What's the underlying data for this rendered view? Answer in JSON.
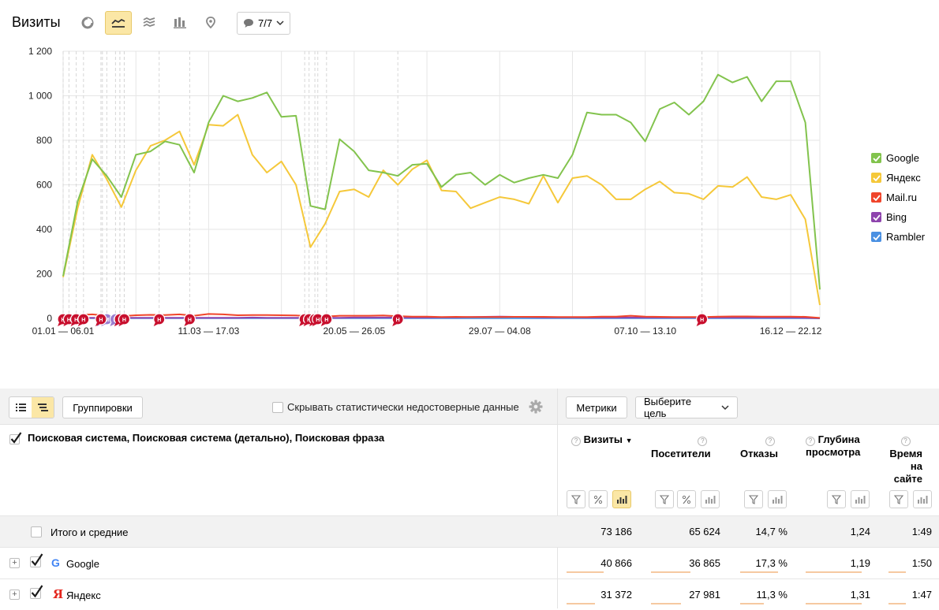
{
  "header": {
    "title": "Визиты",
    "series_dropdown": "7/7"
  },
  "colors": {
    "accent": "#fbe7a6",
    "google": "#82c34d",
    "yandex": "#f5c83a",
    "mailru": "#f0452b",
    "bing": "#8e44ad",
    "rambler": "#4a90e2",
    "annotation": "#c8102e",
    "bing_annotation": "#9b7fd0"
  },
  "chart_data": {
    "type": "line",
    "title": "Визиты",
    "ylim": [
      0,
      1200
    ],
    "y_ticks": [
      "1 200",
      "1 000",
      "800",
      "600",
      "400",
      "200",
      "0"
    ],
    "x_tick_labels": [
      "01.01 — 06.01",
      "11.03 — 17.03",
      "20.05 — 26.05",
      "29.07 — 04.08",
      "07.10 — 13.10",
      "16.12 — 22.12"
    ],
    "x_tick_weeks": [
      0,
      10,
      20,
      30,
      40,
      50
    ],
    "weeks": 53,
    "series": [
      {
        "name": "Google",
        "color": "#82c34d",
        "values": [
          190,
          525,
          715,
          640,
          545,
          735,
          750,
          795,
          780,
          655,
          880,
          1000,
          975,
          990,
          1015,
          905,
          910,
          505,
          490,
          805,
          750,
          665,
          655,
          640,
          690,
          695,
          590,
          645,
          655,
          600,
          645,
          610,
          630,
          645,
          630,
          735,
          925,
          915,
          915,
          880,
          795,
          940,
          970,
          915,
          975,
          1095,
          1060,
          1085,
          975,
          1065,
          1065,
          880,
          130
        ]
      },
      {
        "name": "Яндекс",
        "color": "#f5c83a",
        "values": [
          185,
          495,
          735,
          625,
          500,
          665,
          775,
          800,
          840,
          690,
          870,
          865,
          915,
          735,
          655,
          705,
          600,
          320,
          425,
          570,
          580,
          545,
          665,
          600,
          670,
          710,
          575,
          570,
          495,
          520,
          545,
          535,
          515,
          640,
          520,
          630,
          640,
          600,
          535,
          535,
          580,
          615,
          565,
          560,
          535,
          595,
          590,
          635,
          545,
          535,
          555,
          445,
          60
        ]
      },
      {
        "name": "Mail.ru",
        "color": "#f0452b",
        "values": [
          5,
          15,
          18,
          12,
          10,
          14,
          16,
          15,
          18,
          12,
          20,
          18,
          14,
          15,
          15,
          14,
          13,
          10,
          8,
          12,
          12,
          12,
          13,
          10,
          8,
          8,
          6,
          7,
          6,
          6,
          6,
          7,
          7,
          7,
          6,
          6,
          6,
          8,
          8,
          12,
          8,
          7,
          6,
          6,
          6,
          8,
          9,
          9,
          8,
          8,
          8,
          7,
          2
        ]
      },
      {
        "name": "Bing",
        "color": "#8e44ad",
        "values": [
          1,
          3,
          3,
          2,
          3,
          3,
          3,
          3,
          3,
          3,
          3,
          3,
          3,
          4,
          3,
          3,
          3,
          2,
          3,
          3,
          4,
          4,
          4,
          4,
          4,
          4,
          5,
          5,
          6,
          7,
          8,
          7,
          6,
          5,
          5,
          5,
          4,
          4,
          4,
          4,
          4,
          4,
          4,
          4,
          4,
          4,
          4,
          4,
          4,
          4,
          4,
          3,
          1
        ]
      },
      {
        "name": "Rambler",
        "color": "#4a90e2",
        "values": [
          0,
          1,
          1,
          1,
          1,
          1,
          1,
          1,
          1,
          1,
          1,
          1,
          1,
          1,
          1,
          1,
          1,
          1,
          1,
          1,
          1,
          1,
          1,
          1,
          1,
          1,
          1,
          1,
          1,
          1,
          1,
          1,
          1,
          1,
          1,
          1,
          1,
          1,
          1,
          1,
          1,
          1,
          1,
          1,
          1,
          1,
          1,
          1,
          1,
          1,
          1,
          1,
          0
        ]
      }
    ],
    "annotation_weeks": [
      0,
      0.4,
      0.9,
      1.4,
      2.6,
      3.9,
      4.2,
      6.6,
      8.7,
      16.6,
      16.9,
      17.3,
      17.5,
      18.1,
      23.0,
      43.9
    ],
    "bing_annotation_weeks": [
      2.7,
      3.0,
      3.6,
      3.9,
      4.2
    ],
    "annotation_label": "Н",
    "bing_annotation_label": "М",
    "grid": true,
    "legend_position": "right"
  },
  "legend": [
    {
      "label": "Google",
      "color": "#82c34d"
    },
    {
      "label": "Яндекс",
      "color": "#f5c83a"
    },
    {
      "label": "Mail.ru",
      "color": "#f0452b"
    },
    {
      "label": "Bing",
      "color": "#8e44ad"
    },
    {
      "label": "Rambler",
      "color": "#4a90e2"
    }
  ],
  "toolbar": {
    "groupings_label": "Группировки",
    "hide_unreliable_label": "Скрывать статистически недостоверные данные",
    "metrics_label": "Метрики",
    "goal_label": "Выберите цель"
  },
  "table": {
    "dimension_header": "Поисковая система, Поисковая система (детально), Поисковая фраза",
    "columns": {
      "visits": "Визиты",
      "visitors": "Посетители",
      "bounces": "Отказы",
      "depth_line1": "Глубина",
      "depth_line2": "просмотра",
      "time_line1": "Время",
      "time_line2": "на",
      "time_line3": "сайте"
    },
    "total": {
      "label": "Итого и средние",
      "visits": "73 186",
      "visitors": "65 624",
      "bounces": "14,7 %",
      "depth": "1,24",
      "time": "1:49"
    },
    "rows": [
      {
        "label": "Google",
        "visits": "40 866",
        "visitors": "36 865",
        "bounces": "17,3 %",
        "depth": "1,19",
        "time": "1:50",
        "bar_fractions": {
          "visits": 0.56,
          "visitors": 0.56,
          "bounces": 0.8,
          "depth": 0.85,
          "time": 0.4
        }
      },
      {
        "label": "Яндекс",
        "visits": "31 372",
        "visitors": "27 981",
        "bounces": "11,3 %",
        "depth": "1,31",
        "time": "1:47",
        "bar_fractions": {
          "visits": 0.43,
          "visitors": 0.43,
          "bounces": 0.5,
          "depth": 0.85,
          "time": 0.4
        }
      }
    ]
  }
}
